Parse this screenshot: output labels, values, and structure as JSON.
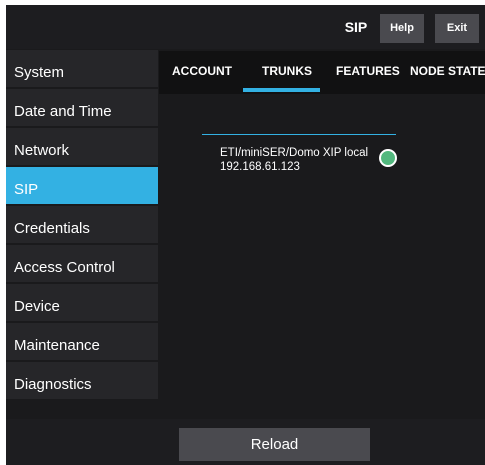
{
  "header": {
    "title": "SIP",
    "help_label": "Help",
    "exit_label": "Exit"
  },
  "sidebar": {
    "items": [
      {
        "label": "System",
        "active": false
      },
      {
        "label": "Date and Time",
        "active": false
      },
      {
        "label": "Network",
        "active": false
      },
      {
        "label": "SIP",
        "active": true
      },
      {
        "label": "Credentials",
        "active": false
      },
      {
        "label": "Access Control",
        "active": false
      },
      {
        "label": "Device",
        "active": false
      },
      {
        "label": "Maintenance",
        "active": false
      },
      {
        "label": "Diagnostics",
        "active": false
      }
    ]
  },
  "tabs": {
    "items": [
      {
        "label": "ACCOUNT",
        "active": false
      },
      {
        "label": "TRUNKS",
        "active": true
      },
      {
        "label": "FEATURES",
        "active": false
      },
      {
        "label": "NODE STATE",
        "active": false
      }
    ]
  },
  "trunk": {
    "name": "ETI/miniSER/Domo XIP local",
    "address": "192.168.61.123",
    "status_color": "#52b87e"
  },
  "footer": {
    "reload_label": "Reload"
  },
  "colors": {
    "accent": "#33b1e3",
    "background": "#1a1a1c"
  }
}
